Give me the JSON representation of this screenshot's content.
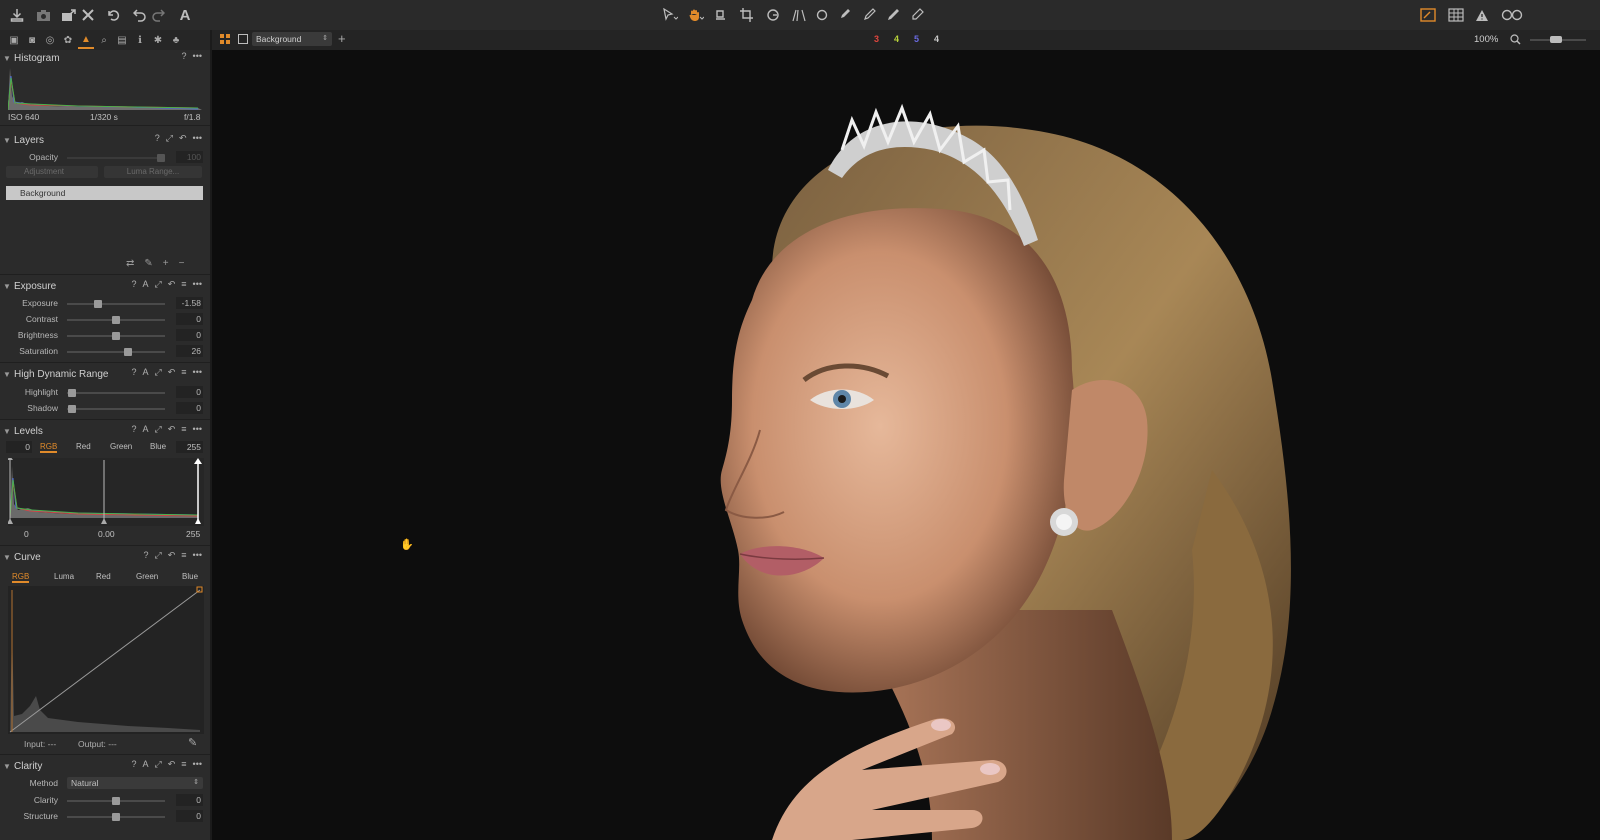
{
  "toolbar": {
    "cursor_tools": [
      "select-arrow",
      "pan-hand",
      "straighten",
      "crop",
      "rotate",
      "keystone",
      "spot-removal",
      "brush",
      "erase-brush",
      "picker",
      "eraser"
    ],
    "right_icons": [
      "viewer-mode",
      "grid-view",
      "warning",
      "proof-glasses"
    ]
  },
  "secondary_bar": {
    "layer_select": "Background",
    "ratings": [
      "3",
      "4",
      "5",
      "4"
    ],
    "rating_colors": [
      "#e0463e",
      "#b8d23a",
      "#6a6ae0",
      "#c8c8c8"
    ],
    "zoom": "100%"
  },
  "histogram": {
    "title": "Histogram",
    "iso": "ISO 640",
    "shutter": "1/320 s",
    "aperture": "f/1.8"
  },
  "layers": {
    "title": "Layers",
    "opacity_label": "Opacity",
    "opacity_value": "100",
    "adjustment_label": "Adjustment",
    "luma_range_label": "Luma Range...",
    "items": [
      "Background"
    ]
  },
  "exposure": {
    "title": "Exposure",
    "sliders": [
      {
        "label": "Exposure",
        "value": "-1.58",
        "pos": 0.32
      },
      {
        "label": "Contrast",
        "value": "0",
        "pos": 0.5
      },
      {
        "label": "Brightness",
        "value": "0",
        "pos": 0.5
      },
      {
        "label": "Saturation",
        "value": "26",
        "pos": 0.62
      }
    ]
  },
  "hdr": {
    "title": "High Dynamic Range",
    "sliders": [
      {
        "label": "Highlight",
        "value": "0",
        "pos": 0.05
      },
      {
        "label": "Shadow",
        "value": "0",
        "pos": 0.05
      }
    ]
  },
  "levels": {
    "title": "Levels",
    "low": "0",
    "high": "255",
    "tabs": [
      "RGB",
      "Red",
      "Green",
      "Blue"
    ],
    "bottom_low": "0",
    "bottom_mid": "0.00",
    "bottom_high": "255"
  },
  "curve": {
    "title": "Curve",
    "tabs": [
      "RGB",
      "Luma",
      "Red",
      "Green",
      "Blue"
    ],
    "input_label": "Input:",
    "input_value": "---",
    "output_label": "Output:",
    "output_value": "---"
  },
  "clarity": {
    "title": "Clarity",
    "method_label": "Method",
    "method_value": "Natural",
    "sliders": [
      {
        "label": "Clarity",
        "value": "0",
        "pos": 0.5
      },
      {
        "label": "Structure",
        "value": "0",
        "pos": 0.5
      }
    ]
  },
  "colors": {
    "accent": "#e08a2a",
    "panel_bg": "#2b2b2b",
    "canvas_bg": "#0d0d0d"
  }
}
